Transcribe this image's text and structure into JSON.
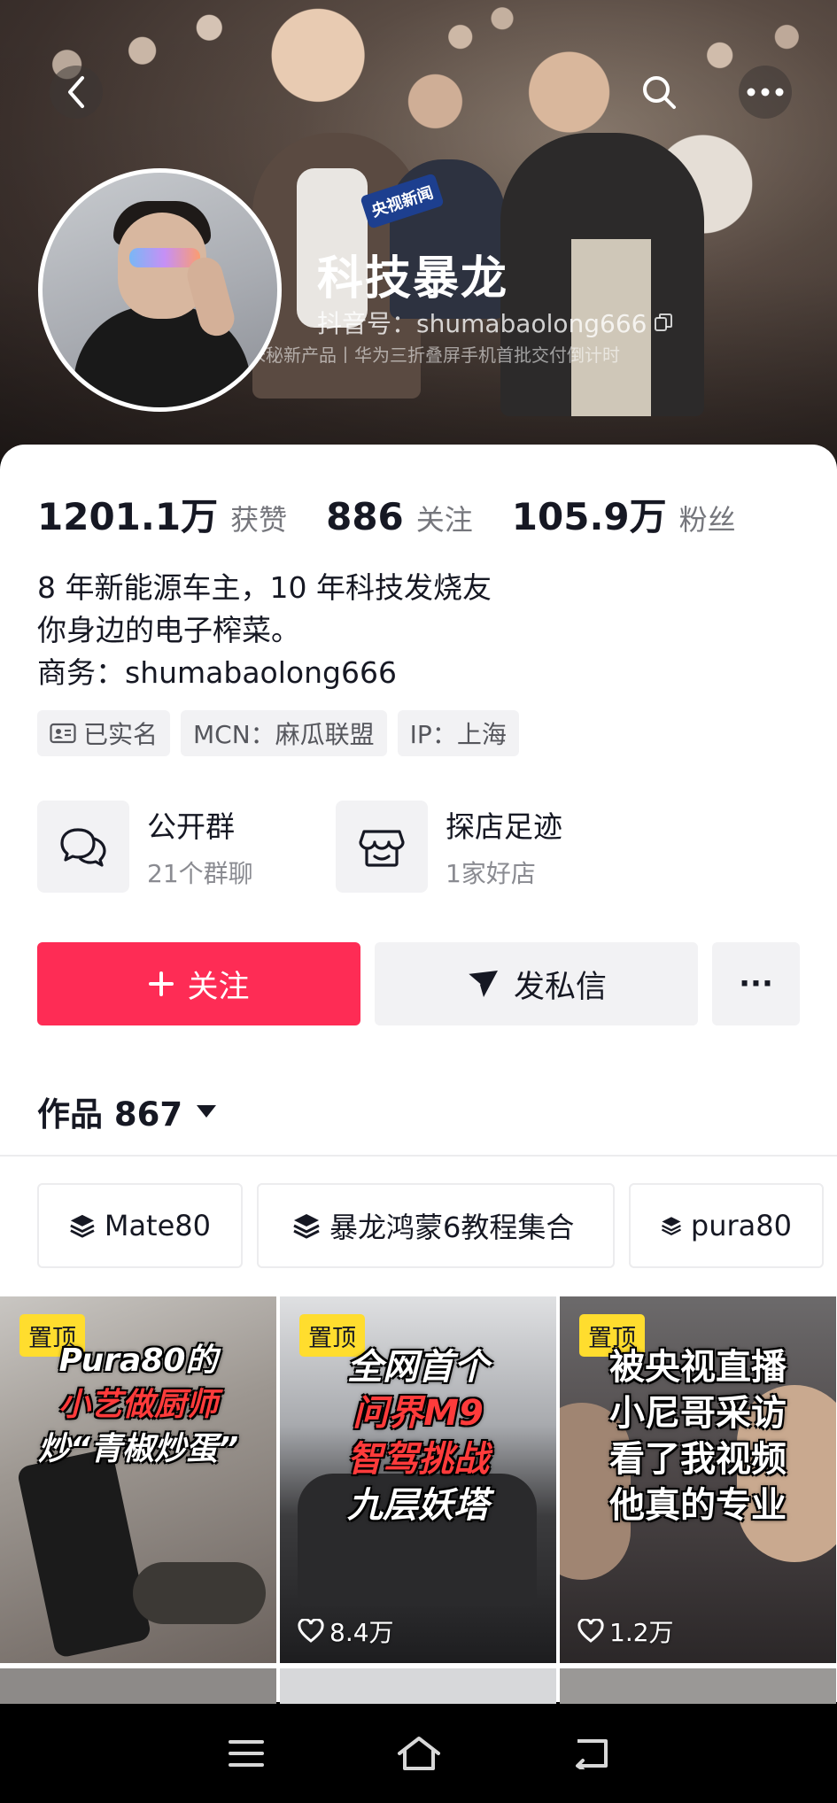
{
  "header": {
    "display_name": "科技暴龙",
    "handle": "抖音号：shumabaolong666",
    "ticker_text": "米秘新产品丨华为三折叠屏手机首批交付倒计时",
    "mic_tag": "央视新闻"
  },
  "stats": [
    {
      "value": "1201.1万",
      "label": "获赞"
    },
    {
      "value": "886",
      "label": "关注"
    },
    {
      "value": "105.9万",
      "label": "粉丝"
    }
  ],
  "bio": {
    "line1": "8 年新能源车主，10 年科技发烧友",
    "line2": "你身边的电子榨菜。",
    "line3": "商务：shumabaolong666"
  },
  "tags": {
    "verified": "已实名",
    "mcn": "MCN：麻瓜联盟",
    "ip": "IP：上海"
  },
  "features": {
    "group": {
      "title": "公开群",
      "subtitle": "21个群聊"
    },
    "shop": {
      "title": "探店足迹",
      "subtitle": "1家好店"
    }
  },
  "actions": {
    "follow": "关注",
    "message": "发私信",
    "more": "···"
  },
  "works": {
    "label": "作品 867"
  },
  "collections": [
    "Mate80",
    "暴龙鸿蒙6教程集合",
    "pura80"
  ],
  "videos": [
    {
      "pin": "置顶",
      "line1": "Pura80的",
      "line2": "小艺做厨师",
      "line3": "炒“青椒炒蛋”",
      "likes": ""
    },
    {
      "pin": "置顶",
      "line1": "全网首个",
      "line2": "问界M9",
      "line3": "智驾挑战",
      "line4": "九层妖塔",
      "likes": "8.4万"
    },
    {
      "pin": "置顶",
      "line1": "被央视直播",
      "line2": "小尼哥采访",
      "line3": "看了我视频",
      "line4": "他真的专业",
      "likes": "1.2万"
    }
  ],
  "colors": {
    "follow": "#fe2c55",
    "pin": "#ffdd2e",
    "secondary_bg": "#f2f2f4"
  }
}
